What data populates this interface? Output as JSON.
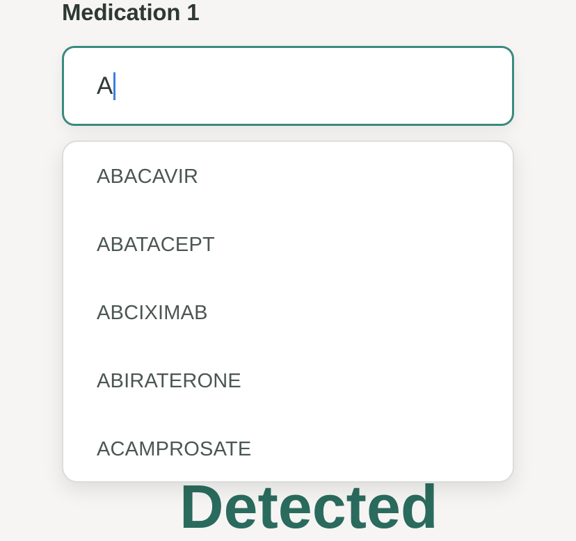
{
  "field": {
    "label": "Medication 1",
    "value": "A"
  },
  "dropdown": {
    "options": [
      "ABACAVIR",
      "ABATACEPT",
      "ABCIXIMAB",
      "ABIRATERONE",
      "ACAMPROSATE"
    ]
  },
  "background": {
    "heading_partial": "Detected"
  },
  "colors": {
    "accent": "#3b8a7e",
    "caret": "#3b7fe0",
    "heading": "#2a6b5e",
    "text": "#4b5653"
  }
}
